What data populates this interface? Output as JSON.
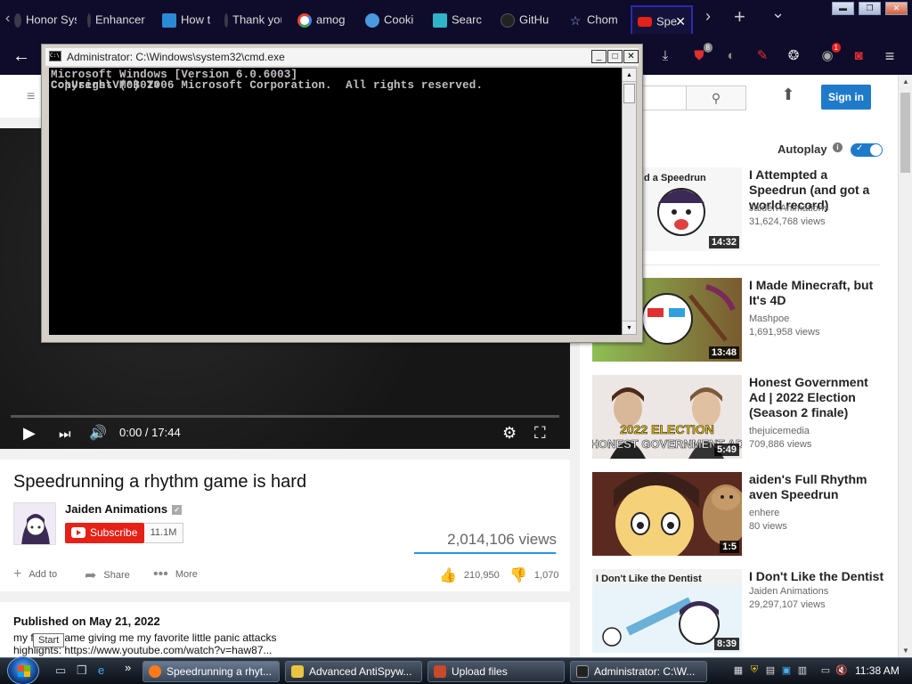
{
  "browser": {
    "tabs": [
      {
        "title": "Honor Sys",
        "favicon_color": "#3a3a4a"
      },
      {
        "title": "Enhancer",
        "favicon_color": "#3a3a4a"
      },
      {
        "title": "How t",
        "favicon_color": "#2a8ad6"
      },
      {
        "title": "Thank you",
        "favicon_color": "#3a3a4a"
      },
      {
        "title": "amog",
        "favicon_color": "#ffffff"
      },
      {
        "title": "Cooki",
        "favicon_color": "#4a9ae0"
      },
      {
        "title": "Searc",
        "favicon_color": "#2fb3c8"
      },
      {
        "title": "GitHu",
        "favicon_color": "#222222"
      },
      {
        "title": "Chom",
        "favicon_color": "#5a7ad8"
      },
      {
        "title": "Spe",
        "favicon_color": "#e62117",
        "active": true
      }
    ],
    "tab_close_glyph": "✕",
    "new_tab_glyph": "+",
    "tab_list_glyph": "⌄",
    "scroll_right_glyph": "›",
    "scroll_left_glyph": "‹",
    "window_controls": {
      "minimize": "▬",
      "restore": "❐",
      "close": "✕"
    },
    "toolbar": {
      "back_glyph": "←",
      "extensions": [
        {
          "name": "download-icon",
          "glyph": "⤓",
          "badge": ""
        },
        {
          "name": "ublock-icon",
          "glyph": "⛊",
          "badge": "8"
        },
        {
          "name": "ghost-extension-icon",
          "glyph": "◐",
          "badge": ""
        },
        {
          "name": "magic-wand-icon",
          "glyph": "✎",
          "badge": ""
        },
        {
          "name": "mask-extension-icon",
          "glyph": "❂",
          "badge": ""
        },
        {
          "name": "notification-extension-icon",
          "glyph": "◉",
          "badge": "1"
        },
        {
          "name": "camera-icon",
          "glyph": "◙",
          "badge": ""
        },
        {
          "name": "menu-icon",
          "glyph": "≡",
          "badge": ""
        }
      ]
    }
  },
  "youtube": {
    "header": {
      "menu_glyph": "≡",
      "search_glyph": "⚲",
      "upload_glyph": "⬆",
      "signin_label": "Sign in"
    },
    "player": {
      "time": "0:00 / 17:44",
      "play_glyph": "▶",
      "next_glyph": "⏭",
      "volume_glyph": "🔊",
      "settings_glyph": "⚙",
      "fullscreen_glyph": "⛶",
      "progress_fraction": 0.0
    },
    "video": {
      "title": "Speedrunning a rhythm game is hard",
      "channel": "Jaiden Animations",
      "verified_glyph": "✓",
      "subscribe_label": "Subscribe",
      "subscriber_count": "11.1M",
      "views": "2,014,106 views",
      "like_ratio": 0.995,
      "actions": {
        "add_to": "Add to",
        "share": "Share",
        "more": "More"
      },
      "likes": "210,950",
      "dislikes": "1,070",
      "published": "Published on May 21, 2022",
      "description_line1": "my f    little game giving me my favorite little panic attacks",
      "description_line2": "highlights: https://www.youtube.com/watch?v=haw87..."
    },
    "sidebar": {
      "autoplay_label": "Autoplay",
      "autoplay_on": true,
      "recommendations": [
        {
          "title": "I Attempted a Speedrun (and got a world record)",
          "channel": "Jaiden Animations",
          "views": "31,624,768 views",
          "duration": "14:32",
          "thumb_color": "#ffffff",
          "thumb_text": "d a Speedrun"
        },
        {
          "title": "I Made Minecraft, but It's 4D",
          "channel": "Mashpoe",
          "views": "1,691,958 views",
          "duration": "13:48",
          "thumb_color": "#8a7a5a",
          "thumb_text": ""
        },
        {
          "title": "Honest Government Ad | 2022 Election (Season 2 finale)",
          "channel": "thejuicemedia",
          "views": "709,886 views",
          "duration": "5:49",
          "thumb_color": "#e8e2e0",
          "thumb_text": "2022 ELECTION HONEST GOVERNMENT AD"
        },
        {
          "title": "aiden's Full Rhythm aven Speedrun",
          "channel": "enhere",
          "views": "80 views",
          "duration": "1:5",
          "thumb_color": "#3a2018",
          "thumb_text": ""
        },
        {
          "title": "I Don't Like the Dentist",
          "channel": "Jaiden Animations",
          "views": "29,297,107 views",
          "duration": "8:39",
          "thumb_color": "#f4f4f4",
          "thumb_text": "I Don't Like the Dentist"
        }
      ]
    }
  },
  "cmd": {
    "title": "Administrator: C:\\Windows\\system32\\cmd.exe",
    "icon_text": "C:\\",
    "lines": [
      "Microsoft Windows [Version 6.0.6003]",
      "Copyright (c) 2006 Microsoft Corporation.  All rights reserved.",
      "",
      "C:\\Users\\VM0B0T>"
    ],
    "btn_min": "_",
    "btn_max": "□",
    "btn_close": "✕"
  },
  "taskbar": {
    "start_tooltip": "Start",
    "quick_launch_more": "»",
    "buttons": [
      {
        "label": "Speedrunning a rhyt...",
        "icon_color": "#ff7a1a"
      },
      {
        "label": "Advanced AntiSpyw...",
        "icon_color": "#e8c440"
      },
      {
        "label": "Upload files",
        "icon_color": "#c84a2a"
      },
      {
        "label": "Administrator: C:\\W...",
        "icon_color": "#222222"
      }
    ],
    "clock": "11:38 AM"
  }
}
